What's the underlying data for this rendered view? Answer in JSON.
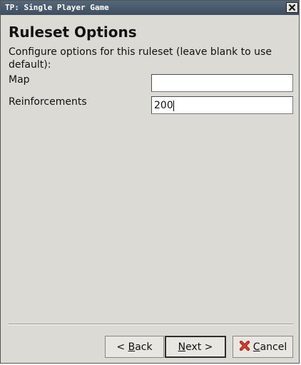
{
  "window": {
    "title": "TP: Single Player Game",
    "close_icon": "close-x-icon"
  },
  "page": {
    "heading": "Ruleset Options",
    "description": "Configure options for this ruleset (leave blank to use default):"
  },
  "fields": [
    {
      "label": "Map",
      "value": ""
    },
    {
      "label": "Reinforcements",
      "value": "200"
    }
  ],
  "buttons": {
    "back": {
      "prefix": "< ",
      "mnemonic": "B",
      "rest": "ack"
    },
    "next": {
      "mnemonic": "N",
      "rest": "ext >"
    },
    "cancel": {
      "mnemonic": "C",
      "rest": "ancel",
      "icon": "red-x-icon"
    }
  },
  "colors": {
    "titlebar": "#485869",
    "window_bg": "#dcdad5",
    "cancel_icon": "#d42a1f"
  }
}
